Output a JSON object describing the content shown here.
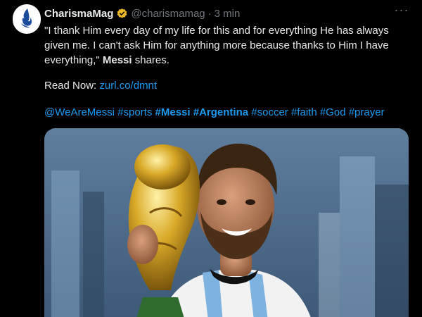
{
  "tweet": {
    "author_name": "CharismaMag",
    "author_handle": "@charismamag",
    "separator": "·",
    "time": "3 min",
    "more_label": "···",
    "text_lines": [
      "\"I thank Him every day of my life for this and for everything He has always",
      "given me. I can't ask Him for anything more because thanks to Him I have"
    ],
    "text_line3_pre": "everything,\" ",
    "text_line3_bold": "Messi",
    "text_line3_post": " shares.",
    "read_now_label": "Read Now:",
    "read_now_link": "zurl.co/dmnt",
    "hashtags": [
      {
        "text": "@WeAreMessi",
        "bold": false
      },
      {
        "text": "#sports",
        "bold": false
      },
      {
        "text": "#Messi",
        "bold": true
      },
      {
        "text": "#Argentina",
        "bold": true
      },
      {
        "text": "#soccer",
        "bold": false
      },
      {
        "text": "#faith",
        "bold": false
      },
      {
        "text": "#God",
        "bold": false
      },
      {
        "text": "#prayer",
        "bold": false
      }
    ]
  },
  "colors": {
    "background": "#000000",
    "text": "#e7e9ea",
    "muted": "#71767b",
    "link": "#1d9bf0",
    "verified_gold": "#e8b829"
  },
  "icons": {
    "avatar": "charisma-logo-icon",
    "verified": "verified-gold-badge-icon",
    "more": "more-options-icon"
  }
}
